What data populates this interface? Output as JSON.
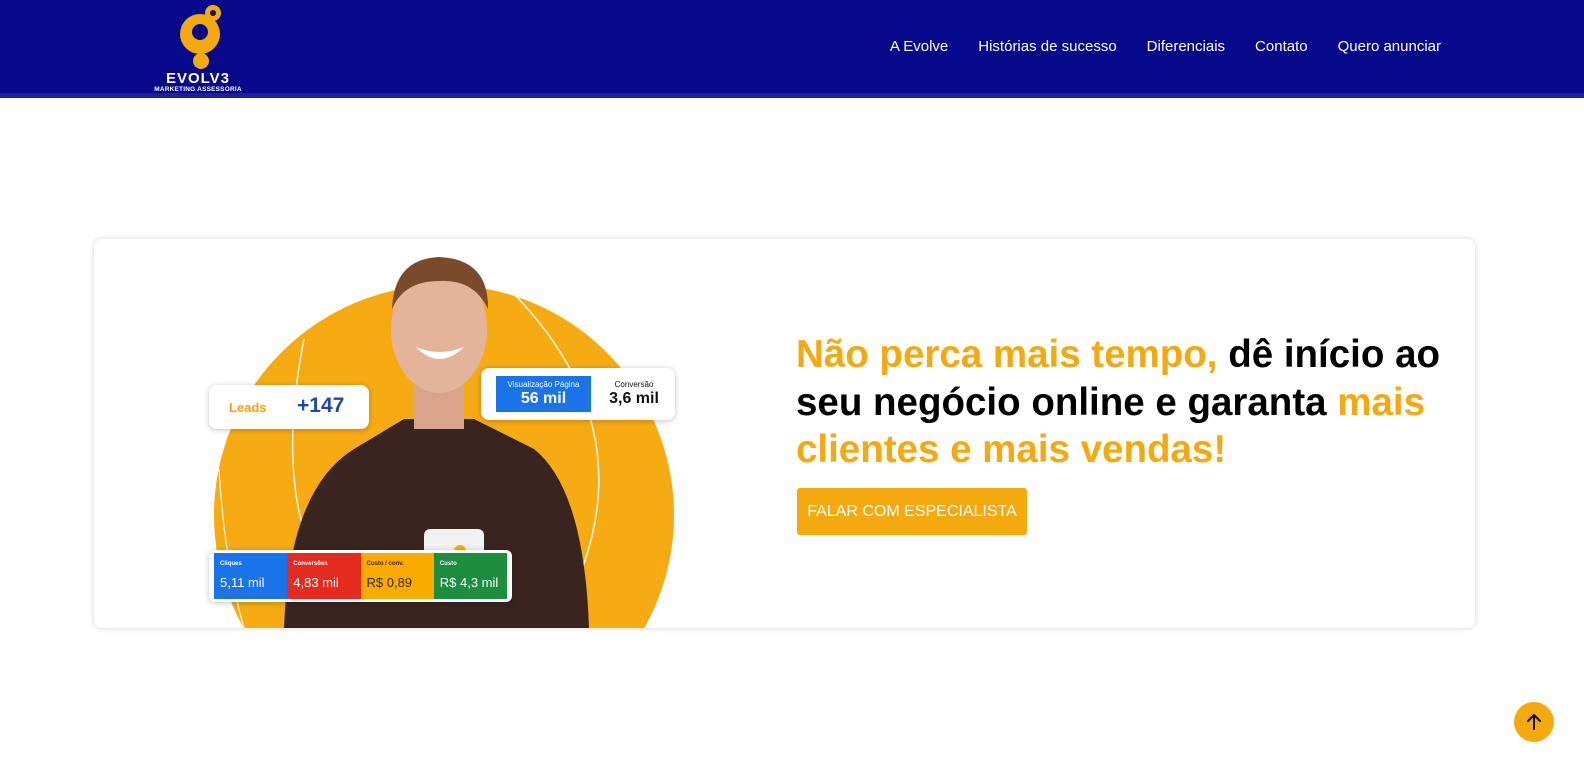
{
  "brand": {
    "name": "EVOLV3",
    "tagline": "MARKETING ASSESSORIA",
    "colors": {
      "navy": "#060a8a",
      "accent": "#f4a90f"
    }
  },
  "nav": {
    "items": [
      {
        "label": "A Evolve"
      },
      {
        "label": "Histórias de sucesso"
      },
      {
        "label": "Diferenciais"
      },
      {
        "label": "Contato"
      },
      {
        "label": "Quero anunciar"
      }
    ]
  },
  "hero": {
    "headline_part1": "Não perca mais tempo,",
    "headline_part2": " dê início ao seu negócio online e garanta ",
    "headline_part3": "mais clientes e mais vendas!",
    "cta_label": "FALAR COM ESPECIALISTA",
    "image": {
      "leads_label": "Leads",
      "leads_value": "+147",
      "views_label": "Visualização Página",
      "views_value": "56 mil",
      "conversion_label": "Conversão",
      "conversion_value": "3,6 mil",
      "metrics": [
        {
          "label": "Cliques",
          "value": "5,11 mil",
          "color": "#1a73e8"
        },
        {
          "label": "Conversões",
          "value": "4,83 mil",
          "color": "#e52a1f"
        },
        {
          "label": "Custo / conv.",
          "value": "R$ 0,89",
          "color": "#f9ab00"
        },
        {
          "label": "Custo",
          "value": "R$ 4,3 mil",
          "color": "#1e8e3e"
        }
      ]
    }
  },
  "scroll_top": {
    "icon": "arrow-up-icon"
  }
}
